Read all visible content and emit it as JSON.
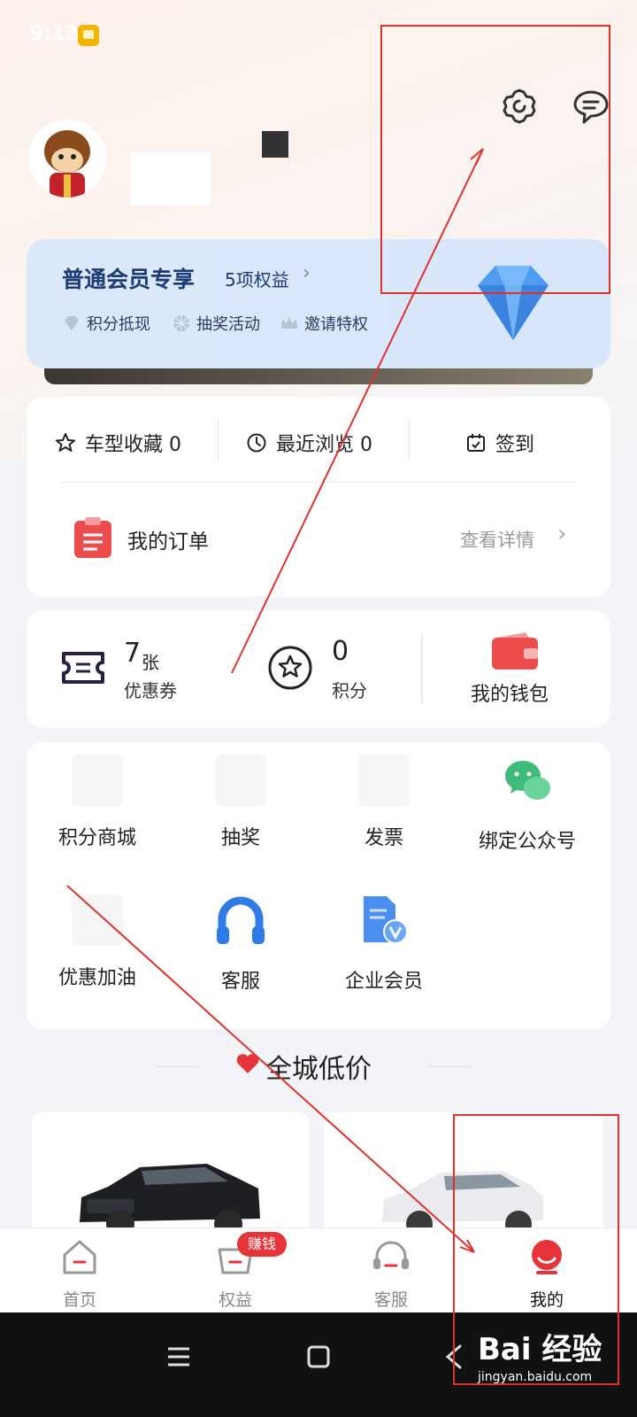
{
  "status_bar": {
    "time": "9:12"
  },
  "header": {
    "settings_icon": "settings-gear-icon",
    "message_icon": "chat-bubble-icon"
  },
  "member_card": {
    "title": "普通会员专享",
    "benefit_count": "5项权益",
    "benefits": [
      {
        "label": "积分抵现",
        "icon": "diamond-small-icon"
      },
      {
        "label": "抽奖活动",
        "icon": "pinwheel-icon"
      },
      {
        "label": "邀请特权",
        "icon": "crown-icon"
      }
    ],
    "colors": {
      "title": "#1b3c74",
      "background": "#dbe8f9"
    }
  },
  "quick_actions": [
    {
      "label": "车型收藏 0",
      "icon": "star-outline-icon"
    },
    {
      "label": "最近浏览 0",
      "icon": "clock-icon"
    },
    {
      "label": "签到",
      "icon": "calendar-check-icon"
    }
  ],
  "order": {
    "label": "我的订单",
    "detail": "查看详情"
  },
  "assets": {
    "coupon_count": "7",
    "coupon_unit": "张",
    "coupon_label": "优惠券",
    "points_value": "0",
    "points_label": "积分",
    "wallet_label": "我的钱包"
  },
  "services": [
    {
      "label": "积分商城"
    },
    {
      "label": "抽奖"
    },
    {
      "label": "发票"
    },
    {
      "label": "绑定公众号",
      "icon": "wechat-icon"
    },
    {
      "label": "优惠加油"
    },
    {
      "label": "客服",
      "icon": "headset-icon"
    },
    {
      "label": "企业会员",
      "icon": "enterprise-document-icon"
    }
  ],
  "section": {
    "title": "全城低价"
  },
  "tab_bar": {
    "tabs": [
      {
        "label": "首页",
        "icon": "home-icon"
      },
      {
        "label": "权益",
        "icon": "basket-icon",
        "badge": "赚钱"
      },
      {
        "label": "客服",
        "icon": "headset-tab-icon"
      },
      {
        "label": "我的",
        "icon": "profile-icon",
        "active": true
      }
    ]
  },
  "watermark": {
    "logo": "Bai 经验",
    "url": "jingyan.baidu.com"
  },
  "colors": {
    "accent_red": "#e8333a",
    "annotation_red": "#e0312a"
  }
}
